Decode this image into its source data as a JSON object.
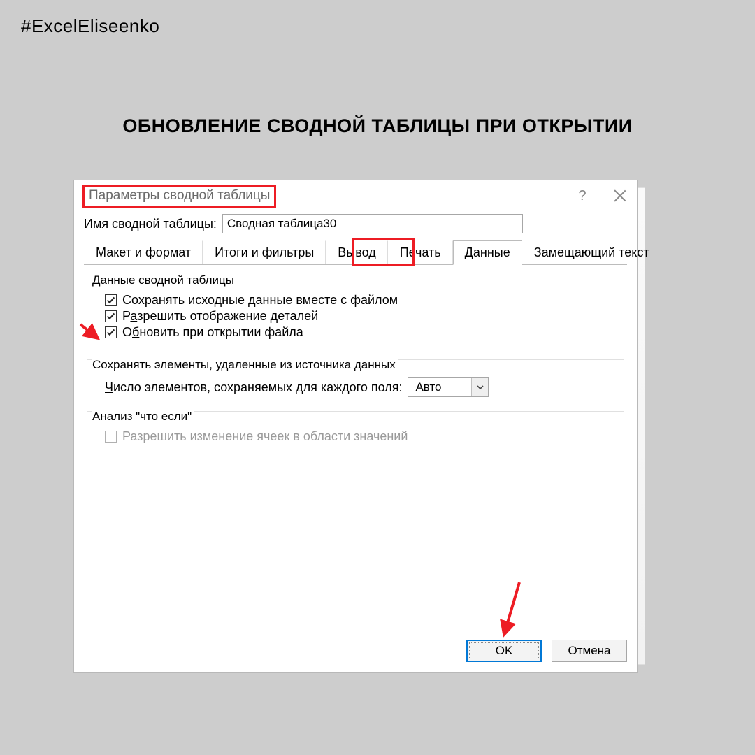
{
  "hashtag": "#ExcelEliseenko",
  "page_heading": "ОБНОВЛЕНИЕ СВОДНОЙ ТАБЛИЦЫ ПРИ ОТКРЫТИИ",
  "dialog": {
    "title": "Параметры сводной таблицы",
    "help_symbol": "?",
    "name_label_pre": "И",
    "name_label_post": "мя сводной таблицы:",
    "name_value": "Сводная таблица30",
    "tabs": [
      {
        "label": "Макет и формат",
        "active": false
      },
      {
        "label": "Итоги и фильтры",
        "active": false
      },
      {
        "label": "Вывод",
        "active": false
      },
      {
        "label": "Печать",
        "active": false
      },
      {
        "label": "Данные",
        "active": true
      },
      {
        "label": "Замещающий текст",
        "active": false
      }
    ],
    "group_data": {
      "legend": "Данные сводной таблицы",
      "cb1_pre": "С",
      "cb1_mid": "о",
      "cb1_post": "хранять исходные данные вместе с файлом",
      "cb2_pre": "Р",
      "cb2_mid": "а",
      "cb2_post": "зрешить отображение деталей",
      "cb3_pre": "О",
      "cb3_mid": "б",
      "cb3_post": "новить при открытии файла"
    },
    "group_retain": {
      "legend": "Сохранять элементы, удаленные из источника данных",
      "row_pre": "Ч",
      "row_post": "исло элементов, сохраняемых для каждого поля:",
      "ddl_value": "Авто"
    },
    "group_whatif": {
      "legend": "Анализ \"что если\"",
      "cb_label": "Разрешить изменение ячеек в области значений"
    },
    "ok_label": "OK",
    "cancel_label": "Отмена"
  },
  "colors": {
    "highlight": "#ed1c24"
  }
}
